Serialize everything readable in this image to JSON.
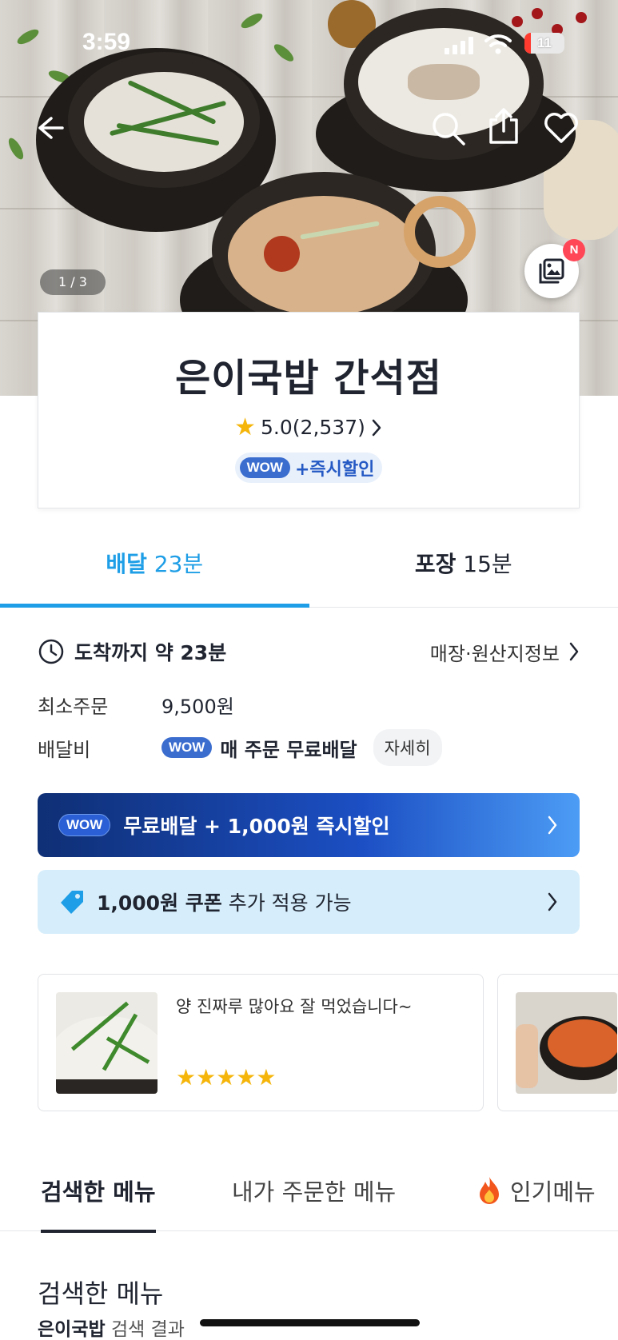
{
  "status_bar": {
    "time": "3:59",
    "battery": "11"
  },
  "hero": {
    "pager": "1 / 3",
    "photo_badge": "N"
  },
  "store": {
    "name": "은이국밥 간석점",
    "rating": "5.0",
    "review_count": "(2,537)",
    "wow_label": "WOW",
    "promo": "+즉시할인"
  },
  "mode_tabs": [
    {
      "label": "배달",
      "time": "23분",
      "active": true
    },
    {
      "label": "포장",
      "time": "15분",
      "active": false
    }
  ],
  "arrival": {
    "text": "도착까지 약 23분",
    "store_info_link": "매장·원산지정보"
  },
  "min_order": {
    "label": "최소주문",
    "value": "9,500원"
  },
  "delivery_fee": {
    "label": "배달비",
    "wow": "WOW",
    "value": "매 주문 무료배달",
    "detail_button": "자세히"
  },
  "wow_banner": {
    "wow": "WOW",
    "text": "무료배달 + 1,000원 즉시할인"
  },
  "coupon_banner": {
    "bold": "1,000원 쿠폰",
    "text": " 추가 적용 가능"
  },
  "reviews": [
    {
      "text": "양 진짜루 많아요 잘 먹었습니다~",
      "rating": 5,
      "stars": "★★★★★"
    }
  ],
  "menu_tabs": [
    {
      "label": "검색한 메뉴",
      "active": true
    },
    {
      "label": "내가 주문한 메뉴",
      "active": false
    },
    {
      "label": "인기메뉴",
      "active": false
    }
  ],
  "searched_section": {
    "title": "검색한 메뉴",
    "keyword": "은이국밥",
    "suffix": " 검색 결과"
  },
  "colors": {
    "accent": "#1e9ee6",
    "wow_blue": "#3b6dcf",
    "star": "#f5b50a",
    "coupon_bg": "#d6eefb"
  },
  "icons": [
    "back-arrow-icon",
    "search-icon",
    "share-icon",
    "heart-icon",
    "photo-review-icon",
    "star-icon",
    "clock-icon",
    "chevron-right-icon",
    "coupon-tag-icon",
    "fire-icon"
  ]
}
